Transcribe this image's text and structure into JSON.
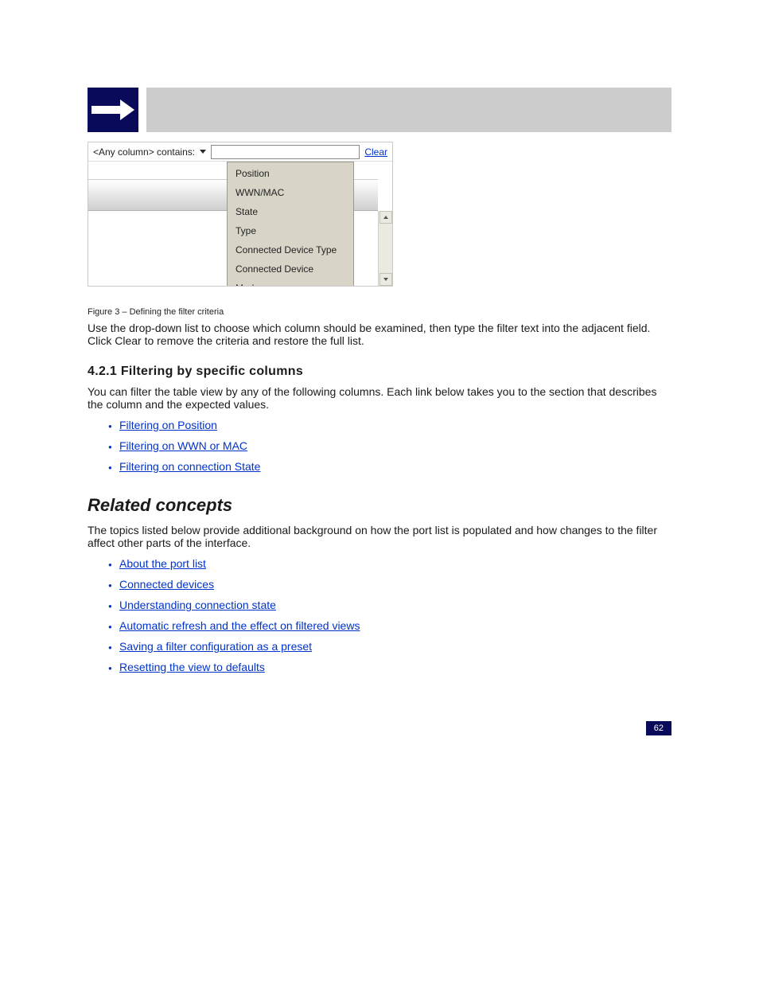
{
  "shot": {
    "filter_label": "<Any column> contains:",
    "clear_label": "Clear",
    "dropdown_items": [
      "Position",
      "WWN/MAC",
      "State",
      "Type",
      "Connected Device Type",
      "Connected Device",
      "Mode"
    ]
  },
  "caption": "Figure 3 – Defining the filter criteria",
  "para_intro": "Use the drop-down list to choose which column should be examined, then type the filter text into the adjacent field. Click Clear to remove the criteria and restore the full list.",
  "h_filter": "4.2.1  Filtering by specific columns",
  "p_filter": "You can filter the table view by any of the following columns. Each link below takes you to the section that describes the column and the expected values.",
  "links1": [
    "Filtering on Position",
    "Filtering on WWN or MAC",
    "Filtering on connection State"
  ],
  "h_related": "Related concepts",
  "p_related": "The topics listed below provide additional background on how the port list is populated and how changes to the filter affect other parts of the interface.",
  "links2": [
    "About the port list",
    "Connected devices",
    "Understanding connection state",
    "Automatic refresh and the effect on filtered views",
    "Saving a filter configuration as a preset",
    "Resetting the view to defaults"
  ],
  "footer_page": "62"
}
